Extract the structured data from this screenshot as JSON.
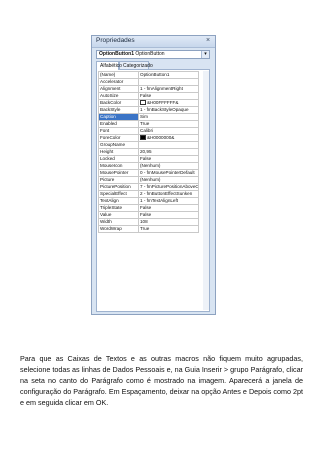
{
  "window": {
    "title": "Propriedades",
    "close_glyph": "×",
    "object_selector": {
      "name": "OptionButton1",
      "type": "OptionButton",
      "dropdown_glyph": "▾"
    },
    "tabs": [
      {
        "label": "Alfabético",
        "active": true
      },
      {
        "label": "Categorizado",
        "active": false
      }
    ],
    "properties": [
      {
        "name": "(Name)",
        "value": "OptionButton1"
      },
      {
        "name": "Accelerator",
        "value": ""
      },
      {
        "name": "Alignment",
        "value": "1 - fmAlignmentRight"
      },
      {
        "name": "AutoSize",
        "value": "False"
      },
      {
        "name": "BackColor",
        "value": "&H00FFFFFF&",
        "swatch": "#ffffff"
      },
      {
        "name": "BackStyle",
        "value": "1 - fmBackStyleOpaque"
      },
      {
        "name": "Caption",
        "value": "Sim",
        "selected": true
      },
      {
        "name": "Enabled",
        "value": "True"
      },
      {
        "name": "Font",
        "value": "Calibri"
      },
      {
        "name": "ForeColor",
        "value": "&H0000000&",
        "swatch": "#000000"
      },
      {
        "name": "GroupName",
        "value": ""
      },
      {
        "name": "Height",
        "value": "20,95"
      },
      {
        "name": "Locked",
        "value": "False"
      },
      {
        "name": "MouseIcon",
        "value": "(Nenhum)"
      },
      {
        "name": "MousePointer",
        "value": "0 - fmMousePointerDefault"
      },
      {
        "name": "Picture",
        "value": "(Nenhum)"
      },
      {
        "name": "PicturePosition",
        "value": "7 - fmPicturePositionAboveCent"
      },
      {
        "name": "SpecialEffect",
        "value": "2 - fmButtonEffectSunken"
      },
      {
        "name": "TextAlign",
        "value": "1 - fmTextAlignLeft"
      },
      {
        "name": "TripleState",
        "value": "False"
      },
      {
        "name": "Value",
        "value": "False"
      },
      {
        "name": "Width",
        "value": "108"
      },
      {
        "name": "WordWrap",
        "value": "True"
      }
    ]
  },
  "document": {
    "paragraph": "Para que as Caixas de Textos e as outras macros não fiquem muito agrupadas, selecione todas as linhas de Dados Pessoais e, na Guia Inserir > grupo Parágrafo, clicar na seta no canto do Parágrafo como é mostrado na imagem. Aparecerá a janela de configuração do Parágrafo. Em Espaçamento, deixar na opção Antes e Depois como 2pt e em seguida clicar em OK."
  }
}
